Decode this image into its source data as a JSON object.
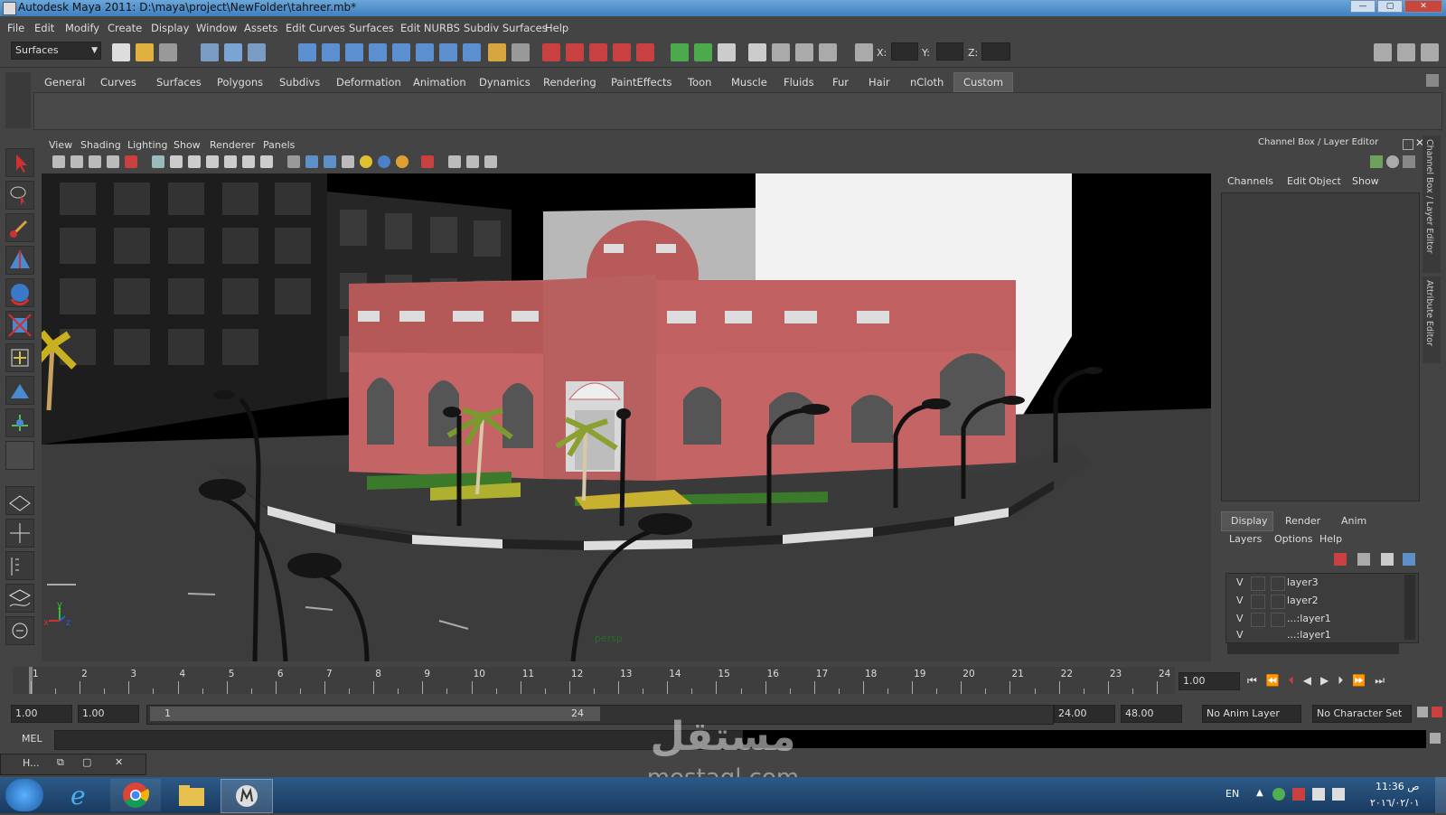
{
  "window": {
    "title": "Autodesk Maya 2011: D:\\maya\\project\\NewFolder\\tahreer.mb*"
  },
  "menu": [
    "File",
    "Edit",
    "Modify",
    "Create",
    "Display",
    "Window",
    "Assets",
    "Edit Curves",
    "Surfaces",
    "Edit NURBS",
    "Subdiv Surfaces",
    "Help"
  ],
  "status_line": {
    "mode": "Surfaces",
    "x_label": "X:",
    "y_label": "Y:",
    "z_label": "Z:"
  },
  "shelf_tabs": [
    "General",
    "Curves",
    "Surfaces",
    "Polygons",
    "Subdivs",
    "Deformation",
    "Animation",
    "Dynamics",
    "Rendering",
    "PaintEffects",
    "Toon",
    "Muscle",
    "Fluids",
    "Fur",
    "Hair",
    "nCloth",
    "Custom"
  ],
  "shelf_active": "Custom",
  "panel_menu": [
    "View",
    "Shading",
    "Lighting",
    "Show",
    "Renderer",
    "Panels"
  ],
  "viewport": {
    "camera_label": "persp",
    "axis_x": "x",
    "axis_y": "y",
    "axis_z": "z"
  },
  "channel_box": {
    "title": "Channel Box / Layer Editor",
    "menu": [
      "Channels",
      "Edit",
      "Object",
      "Show"
    ],
    "side_tab_1": "Channel Box / Layer Editor",
    "side_tab_2": "Attribute Editor"
  },
  "layer_editor": {
    "tabs": [
      "Display",
      "Render",
      "Anim"
    ],
    "active_tab": "Display",
    "menu": [
      "Layers",
      "Options",
      "Help"
    ],
    "layers": [
      {
        "visible": "V",
        "name": "layer3"
      },
      {
        "visible": "V",
        "name": "layer2"
      },
      {
        "visible": "V",
        "name": "...:layer1"
      },
      {
        "visible": "V",
        "name": "...:layer1"
      }
    ]
  },
  "timeline": {
    "ticks": [
      "1",
      "2",
      "3",
      "4",
      "5",
      "6",
      "7",
      "8",
      "9",
      "10",
      "11",
      "12",
      "13",
      "14",
      "15",
      "16",
      "17",
      "18",
      "19",
      "20",
      "21",
      "22",
      "23",
      "24"
    ],
    "current_frame": "1.00"
  },
  "range": {
    "start": "1.00",
    "playback_start": "1.00",
    "slider_min": "1",
    "slider_max": "24",
    "playback_end": "24.00",
    "end": "48.00",
    "anim_layer": "No Anim Layer",
    "character_set": "No Character Set"
  },
  "command_line": {
    "label": "MEL"
  },
  "minimized_window": {
    "label": "H..."
  },
  "taskbar": {
    "language": "EN",
    "time": "11:36 ص",
    "date": "٢٠١٦/٠٢/٠١"
  },
  "watermark": {
    "line1": "مستقل",
    "line2": "mostaql.com"
  },
  "colors": {
    "titlebar": "#4f8cc9",
    "facade": "#c86a6a",
    "bg": "#444444",
    "viewport_bg": "#000000"
  }
}
